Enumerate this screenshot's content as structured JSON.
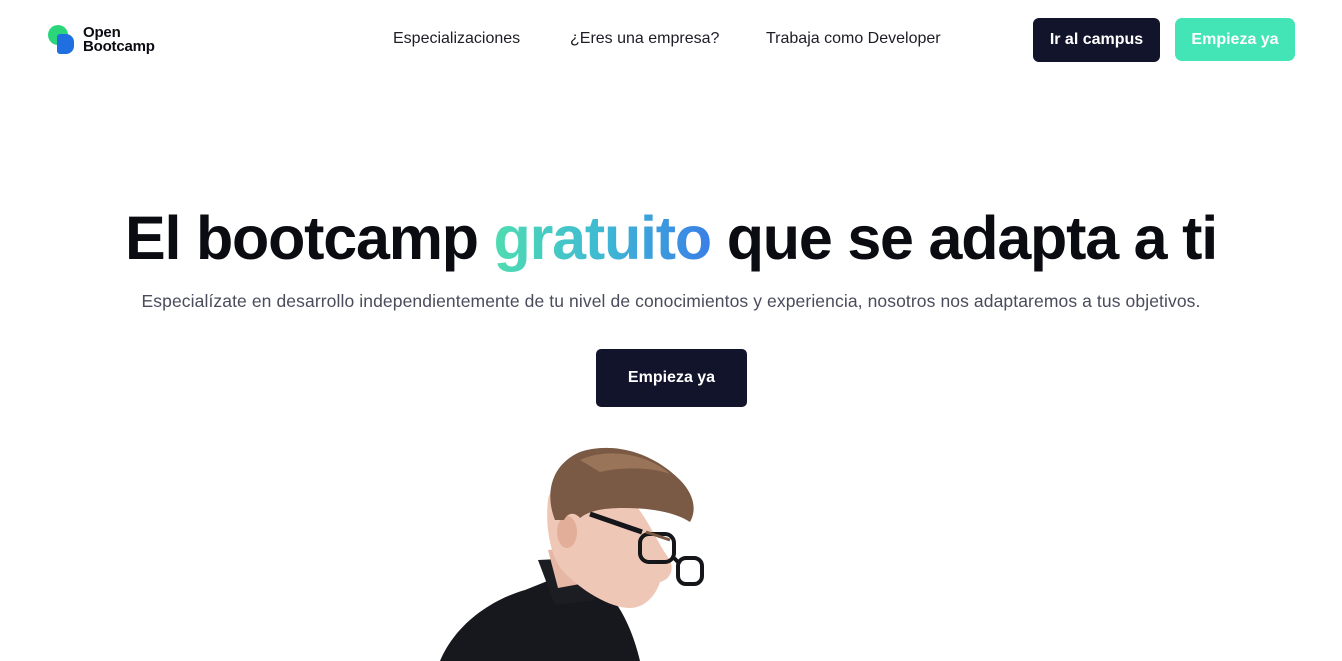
{
  "header": {
    "logo": {
      "line1": "Open",
      "line2": "Bootcamp"
    },
    "nav": [
      {
        "label": "Especializaciones"
      },
      {
        "label": "¿Eres una empresa?"
      },
      {
        "label": "Trabaja como Developer"
      }
    ],
    "campus_button": "Ir al campus",
    "start_button": "Empieza ya"
  },
  "hero": {
    "title_before": "El bootcamp ",
    "title_highlight": "gratuito",
    "title_after": " que se adapta a ti",
    "subtitle": "Especialízate en desarrollo independientemente de tu nivel de conocimientos y experiencia, nosotros nos adaptaremos a tus objetivos.",
    "cta": "Empieza ya"
  },
  "colors": {
    "brand_dark": "#12142b",
    "brand_green": "#43e5b6",
    "gradient_start": "#4fdcb0",
    "gradient_end": "#3a7fe6"
  }
}
